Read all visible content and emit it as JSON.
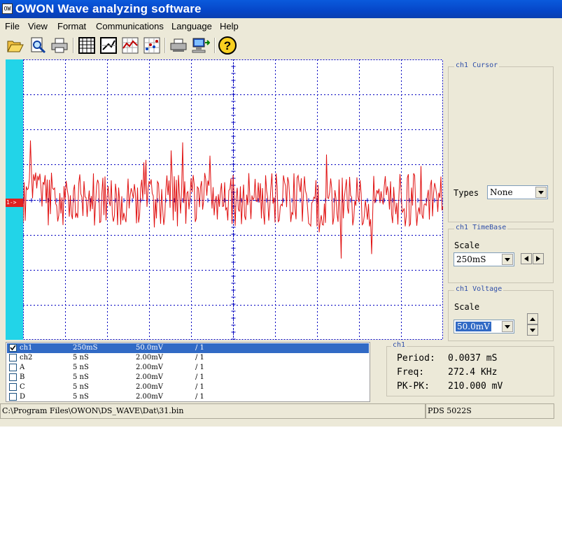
{
  "window": {
    "title": "OWON Wave analyzing software",
    "app_icon_text": "OW"
  },
  "menu": [
    "File",
    "View",
    "Format",
    "Communications",
    "Language",
    "Help"
  ],
  "toolbar": [
    "open-icon",
    "zoom-preview-icon",
    "print-icon",
    "table-icon",
    "edit-icon",
    "chart-icon",
    "dot-chart-icon",
    "printer-setup-icon",
    "communication-icon",
    "help-icon"
  ],
  "scope": {
    "channel_marker": "1->",
    "colors": {
      "trace": "#e01010",
      "grid": "#0000c0",
      "cyan_strip": "#22d4e8"
    }
  },
  "cursor_panel": {
    "title": "ch1 Cursor",
    "types_label": "Types",
    "types_value": "None"
  },
  "timebase_panel": {
    "title": "ch1 TimeBase",
    "scale_label": "Scale",
    "scale_value": "250mS"
  },
  "voltage_panel": {
    "title": "ch1 Voltage",
    "scale_label": "Scale",
    "scale_value": "50.0mV"
  },
  "channels": [
    {
      "name": "ch1",
      "time": "250mS",
      "volt": "50.0mV",
      "probe": "/ 1",
      "checked": true,
      "selected": true
    },
    {
      "name": "ch2",
      "time": "5  nS",
      "volt": "2.00mV",
      "probe": "/ 1",
      "checked": false,
      "selected": false
    },
    {
      "name": "A",
      "time": "5  nS",
      "volt": "2.00mV",
      "probe": "/ 1",
      "checked": false,
      "selected": false
    },
    {
      "name": "B",
      "time": "5  nS",
      "volt": "2.00mV",
      "probe": "/ 1",
      "checked": false,
      "selected": false
    },
    {
      "name": "C",
      "time": "5  nS",
      "volt": "2.00mV",
      "probe": "/ 1",
      "checked": false,
      "selected": false
    },
    {
      "name": "D",
      "time": "5  nS",
      "volt": "2.00mV",
      "probe": "/ 1",
      "checked": false,
      "selected": false
    }
  ],
  "measurements": {
    "title": "ch1",
    "period_label": "Period:",
    "period_value": "0.0037 mS",
    "freq_label": "Freq:",
    "freq_value": "272.4 KHz",
    "pkpk_label": "PK-PK:",
    "pkpk_value": "210.000 mV"
  },
  "status": {
    "path": "C:\\Program Files\\OWON\\DS_WAVE\\Dat\\31.bin",
    "model": "PDS 5022S"
  }
}
